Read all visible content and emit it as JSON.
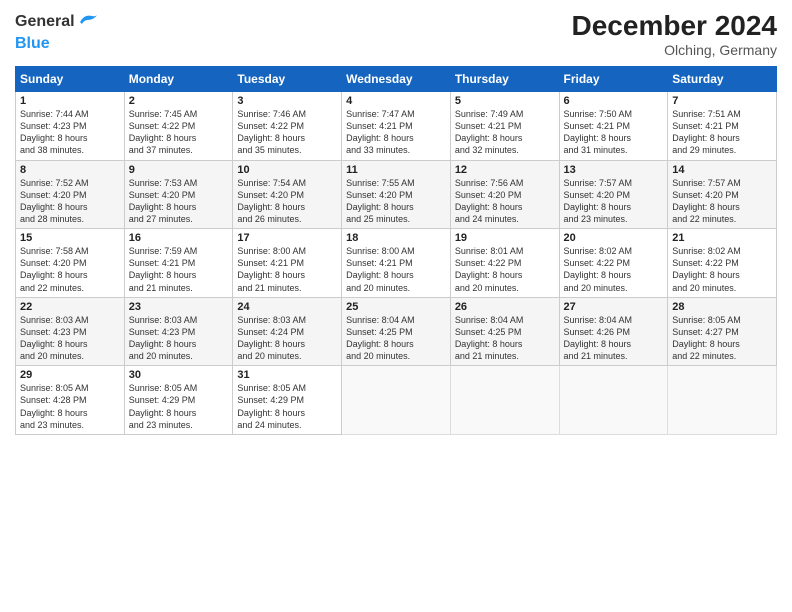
{
  "header": {
    "logo_line1": "General",
    "logo_line2": "Blue",
    "month_year": "December 2024",
    "location": "Olching, Germany"
  },
  "days_of_week": [
    "Sunday",
    "Monday",
    "Tuesday",
    "Wednesday",
    "Thursday",
    "Friday",
    "Saturday"
  ],
  "weeks": [
    [
      {
        "day": "1",
        "info": "Sunrise: 7:44 AM\nSunset: 4:23 PM\nDaylight: 8 hours\nand 38 minutes."
      },
      {
        "day": "2",
        "info": "Sunrise: 7:45 AM\nSunset: 4:22 PM\nDaylight: 8 hours\nand 37 minutes."
      },
      {
        "day": "3",
        "info": "Sunrise: 7:46 AM\nSunset: 4:22 PM\nDaylight: 8 hours\nand 35 minutes."
      },
      {
        "day": "4",
        "info": "Sunrise: 7:47 AM\nSunset: 4:21 PM\nDaylight: 8 hours\nand 33 minutes."
      },
      {
        "day": "5",
        "info": "Sunrise: 7:49 AM\nSunset: 4:21 PM\nDaylight: 8 hours\nand 32 minutes."
      },
      {
        "day": "6",
        "info": "Sunrise: 7:50 AM\nSunset: 4:21 PM\nDaylight: 8 hours\nand 31 minutes."
      },
      {
        "day": "7",
        "info": "Sunrise: 7:51 AM\nSunset: 4:21 PM\nDaylight: 8 hours\nand 29 minutes."
      }
    ],
    [
      {
        "day": "8",
        "info": "Sunrise: 7:52 AM\nSunset: 4:20 PM\nDaylight: 8 hours\nand 28 minutes."
      },
      {
        "day": "9",
        "info": "Sunrise: 7:53 AM\nSunset: 4:20 PM\nDaylight: 8 hours\nand 27 minutes."
      },
      {
        "day": "10",
        "info": "Sunrise: 7:54 AM\nSunset: 4:20 PM\nDaylight: 8 hours\nand 26 minutes."
      },
      {
        "day": "11",
        "info": "Sunrise: 7:55 AM\nSunset: 4:20 PM\nDaylight: 8 hours\nand 25 minutes."
      },
      {
        "day": "12",
        "info": "Sunrise: 7:56 AM\nSunset: 4:20 PM\nDaylight: 8 hours\nand 24 minutes."
      },
      {
        "day": "13",
        "info": "Sunrise: 7:57 AM\nSunset: 4:20 PM\nDaylight: 8 hours\nand 23 minutes."
      },
      {
        "day": "14",
        "info": "Sunrise: 7:57 AM\nSunset: 4:20 PM\nDaylight: 8 hours\nand 22 minutes."
      }
    ],
    [
      {
        "day": "15",
        "info": "Sunrise: 7:58 AM\nSunset: 4:20 PM\nDaylight: 8 hours\nand 22 minutes."
      },
      {
        "day": "16",
        "info": "Sunrise: 7:59 AM\nSunset: 4:21 PM\nDaylight: 8 hours\nand 21 minutes."
      },
      {
        "day": "17",
        "info": "Sunrise: 8:00 AM\nSunset: 4:21 PM\nDaylight: 8 hours\nand 21 minutes."
      },
      {
        "day": "18",
        "info": "Sunrise: 8:00 AM\nSunset: 4:21 PM\nDaylight: 8 hours\nand 20 minutes."
      },
      {
        "day": "19",
        "info": "Sunrise: 8:01 AM\nSunset: 4:22 PM\nDaylight: 8 hours\nand 20 minutes."
      },
      {
        "day": "20",
        "info": "Sunrise: 8:02 AM\nSunset: 4:22 PM\nDaylight: 8 hours\nand 20 minutes."
      },
      {
        "day": "21",
        "info": "Sunrise: 8:02 AM\nSunset: 4:22 PM\nDaylight: 8 hours\nand 20 minutes."
      }
    ],
    [
      {
        "day": "22",
        "info": "Sunrise: 8:03 AM\nSunset: 4:23 PM\nDaylight: 8 hours\nand 20 minutes."
      },
      {
        "day": "23",
        "info": "Sunrise: 8:03 AM\nSunset: 4:23 PM\nDaylight: 8 hours\nand 20 minutes."
      },
      {
        "day": "24",
        "info": "Sunrise: 8:03 AM\nSunset: 4:24 PM\nDaylight: 8 hours\nand 20 minutes."
      },
      {
        "day": "25",
        "info": "Sunrise: 8:04 AM\nSunset: 4:25 PM\nDaylight: 8 hours\nand 20 minutes."
      },
      {
        "day": "26",
        "info": "Sunrise: 8:04 AM\nSunset: 4:25 PM\nDaylight: 8 hours\nand 21 minutes."
      },
      {
        "day": "27",
        "info": "Sunrise: 8:04 AM\nSunset: 4:26 PM\nDaylight: 8 hours\nand 21 minutes."
      },
      {
        "day": "28",
        "info": "Sunrise: 8:05 AM\nSunset: 4:27 PM\nDaylight: 8 hours\nand 22 minutes."
      }
    ],
    [
      {
        "day": "29",
        "info": "Sunrise: 8:05 AM\nSunset: 4:28 PM\nDaylight: 8 hours\nand 23 minutes."
      },
      {
        "day": "30",
        "info": "Sunrise: 8:05 AM\nSunset: 4:29 PM\nDaylight: 8 hours\nand 23 minutes."
      },
      {
        "day": "31",
        "info": "Sunrise: 8:05 AM\nSunset: 4:29 PM\nDaylight: 8 hours\nand 24 minutes."
      },
      null,
      null,
      null,
      null
    ]
  ]
}
